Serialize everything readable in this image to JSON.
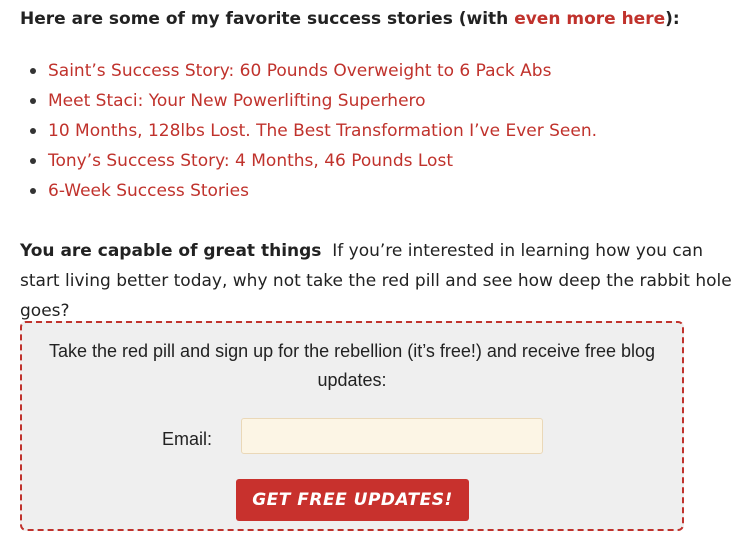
{
  "intro": {
    "text_before": "Here are some of my favorite success stories (with ",
    "link": "even more here",
    "text_after": "):"
  },
  "stories": [
    {
      "label": "Saint’s Success Story: 60 Pounds Overweight to 6 Pack Abs"
    },
    {
      "label": "Meet Staci: Your New Powerlifting Superhero"
    },
    {
      "label": "10 Months, 128lbs Lost. The Best Transformation I’ve Ever Seen."
    },
    {
      "label": "Tony’s Success Story: 4 Months, 46 Pounds Lost"
    },
    {
      "label": "6-Week Success Stories"
    }
  ],
  "capable": {
    "heading": "You are capable of great things",
    "text": "If you’re interested in learning how you can start living better today, why not take the red pill and see how deep the rabbit hole goes?"
  },
  "optin": {
    "text": "Take the red pill and sign up for the rebellion (it’s free!) and receive free blog updates:",
    "email_label": "Email:",
    "email_value": "",
    "button_label": "GET FREE UPDATES!"
  },
  "colors": {
    "link": "#c0322c",
    "button": "#c8312d",
    "box_background": "#efefef",
    "input_background": "#fcf5e5"
  }
}
